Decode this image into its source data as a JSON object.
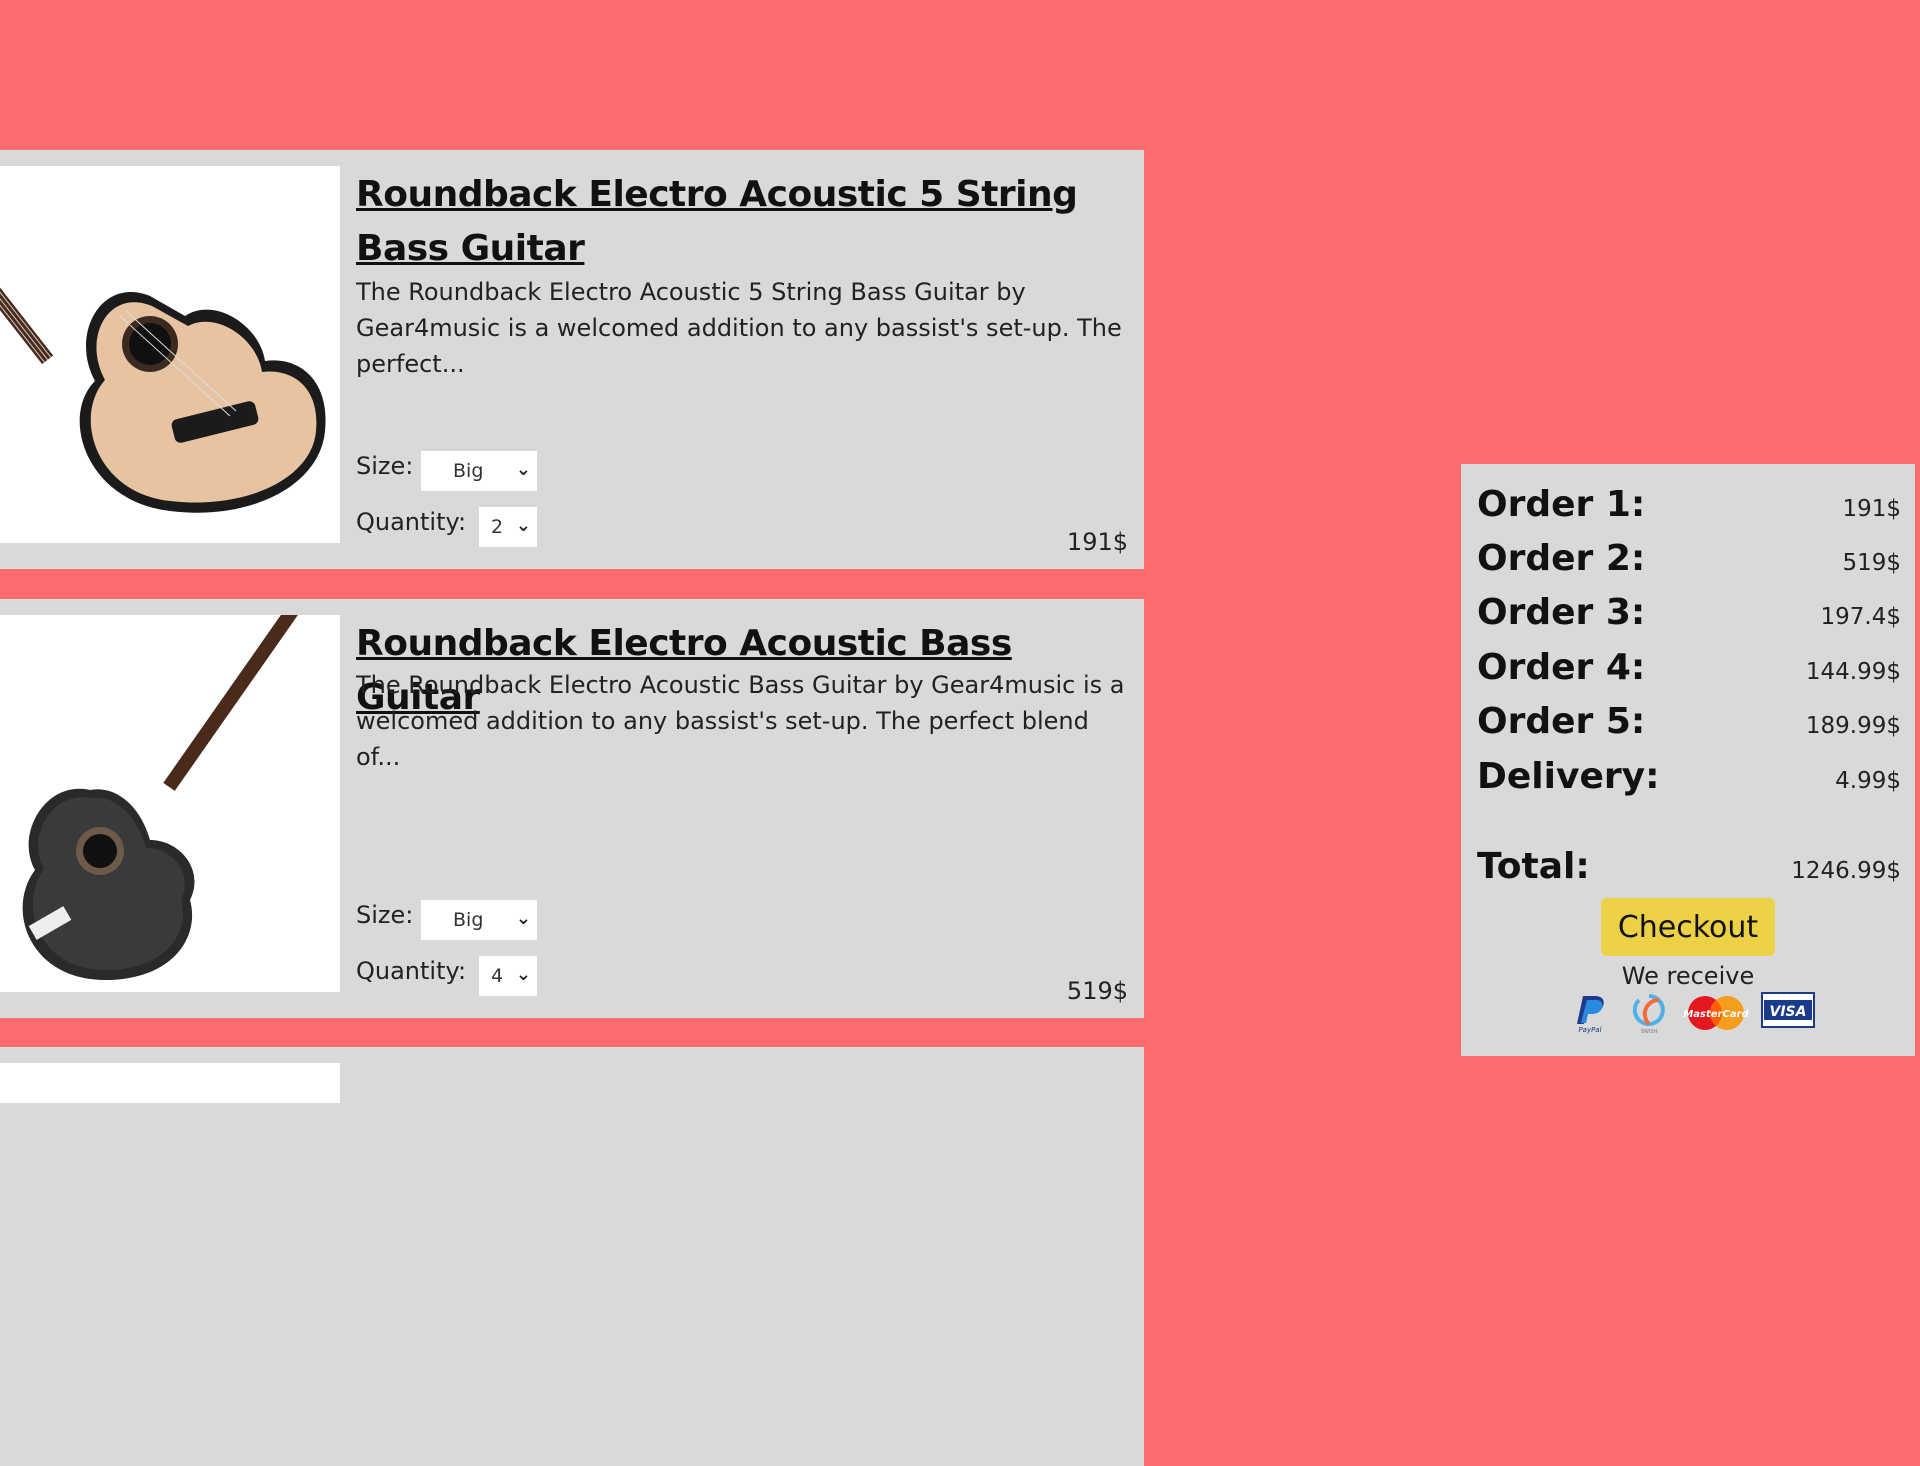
{
  "products": [
    {
      "title": "Roundback Electro Acoustic 5 String Bass Guitar",
      "description": "The Roundback Electro Acoustic 5 String Bass Guitar by Gear4music is a welcomed addition to any bassist's set-up. The perfect...",
      "size_label": "Size:",
      "size_value": "Big",
      "quantity_label": "Quantity:",
      "quantity_value": "2",
      "price": "191$",
      "image_icon": "acoustic-bass-natural-icon"
    },
    {
      "title": "Roundback Electro Acoustic Bass Guitar",
      "description": "The Roundback Electro Acoustic Bass Guitar by Gear4music is a welcomed addition to any bassist's set-up. The perfect blend of...",
      "size_label": "Size:",
      "size_value": "Big",
      "quantity_label": "Quantity:",
      "quantity_value": "4",
      "price": "519$",
      "image_icon": "acoustic-bass-black-icon"
    }
  ],
  "summary": {
    "rows": [
      {
        "label": "Order 1:",
        "value": "191$"
      },
      {
        "label": "Order 2:",
        "value": "519$"
      },
      {
        "label": "Order 3:",
        "value": "197.4$"
      },
      {
        "label": "Order 4:",
        "value": "144.99$"
      },
      {
        "label": "Order 5:",
        "value": "189.99$"
      },
      {
        "label": "Delivery:",
        "value": "4.99$"
      }
    ],
    "total_label": "Total:",
    "total_value": "1246.99$",
    "checkout_label": "Checkout",
    "we_receive_label": "We receive",
    "payment_icons": [
      "paypal-icon",
      "swish-icon",
      "mastercard-icon",
      "visa-icon"
    ],
    "colors": {
      "page_background": "#fc6c6d",
      "card_background": "#d9d9d9",
      "checkout_button": "#ecd045"
    }
  }
}
